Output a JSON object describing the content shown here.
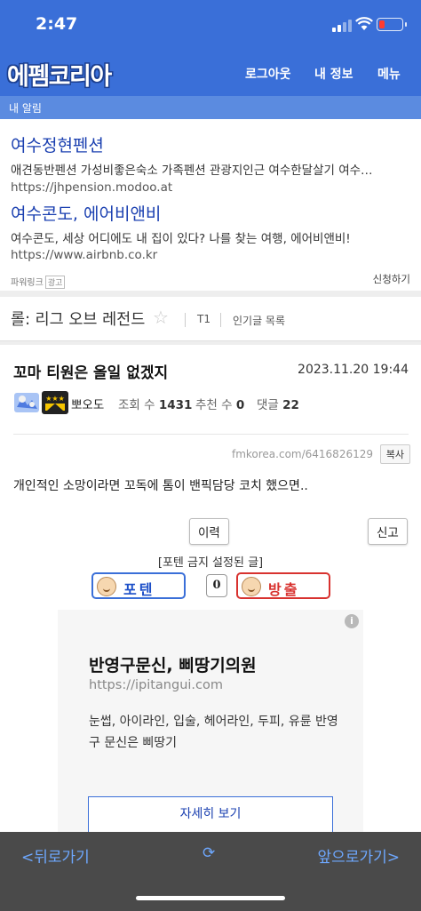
{
  "status_bar": {
    "time": "2:47"
  },
  "header": {
    "logo": "에펨코리아",
    "nav": [
      "로그아웃",
      "내 정보",
      "메뉴"
    ],
    "subbar": "내 알림"
  },
  "ads": [
    {
      "title": "여수정현펜션",
      "desc": "애견동반펜션 가성비좋은숙소 가족펜션 관광지인근 여수한달살기 여수…",
      "url": "https://jhpension.modoo.at"
    },
    {
      "title": "여수콘도, 에어비앤비",
      "desc": "여수콘도, 세상 어디에도 내 집이 있다? 나를 찾는 여행, 에어비앤비!",
      "url": "https://www.airbnb.co.kr"
    }
  ],
  "powerlink": {
    "label": "파워링크",
    "badge": "광고",
    "apply": "신청하기"
  },
  "board": {
    "title": "롤: 리그 오브 레전드",
    "tab": "T1",
    "popular": "인기글 목록"
  },
  "post": {
    "title": "꼬마 티원은 올일 없겠지",
    "date": "2023.11.20 19:44",
    "author": "뽀오도",
    "views_label": "조회 수",
    "views": "1431",
    "recommend_label": "추천 수",
    "recommend": "0",
    "comments_label": "댓글",
    "comments": "22",
    "source_url": "fmkorea.com/6416826129",
    "copy": "복사",
    "content": "개인적인 소망이라면 꼬독에 톰이 밴픽담당 코치 했으면..",
    "history_btn": "이력",
    "report_btn": "신고",
    "notice": "[포텐 금지 설정된 글]",
    "vote_up": "포텐",
    "vote_count": "0",
    "vote_down": "방출"
  },
  "ad_card": {
    "title": "반영구문신, 삐땅기의원",
    "url": "https://ipitangui.com",
    "desc": "눈썹, 아이라인, 입술, 헤어라인, 두피, 유륜 반영구 문신은 삐땅기",
    "more": "자세히 보기",
    "info": "i"
  },
  "bottom_bar": {
    "back": "<뒤로가기",
    "forward": "앞으로가기>",
    "reload": "⟳"
  },
  "colors": {
    "accent": "#3a6fd8",
    "link": "#1a3fb0",
    "down": "#d8322f",
    "bottom_bar": "#4a4a4a"
  }
}
